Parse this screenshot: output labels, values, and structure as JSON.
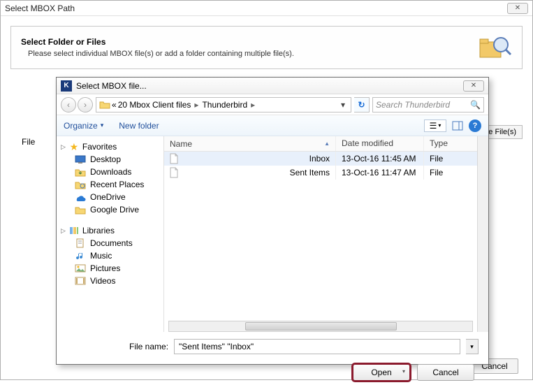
{
  "outer": {
    "title": "Select MBOX Path",
    "info_heading": "Select Folder or Files",
    "info_text": "Please select individual MBOX file(s) or add a folder containing multiple file(s).",
    "e_files_btn": "e File(s)",
    "file_label": "File",
    "cancel": "Cancel"
  },
  "dialog": {
    "title": "Select MBOX file...",
    "breadcrumb": {
      "pre": "«",
      "seg1": "20 Mbox Client files",
      "seg2": "Thunderbird"
    },
    "search_placeholder": "Search Thunderbird",
    "toolbar": {
      "organize": "Organize",
      "newfolder": "New folder"
    },
    "columns": {
      "name": "Name",
      "date": "Date modified",
      "type": "Type"
    },
    "files": [
      {
        "name": "Inbox",
        "date": "13-Oct-16 11:45 AM",
        "type": "File",
        "selected": true
      },
      {
        "name": "Sent Items",
        "date": "13-Oct-16 11:47 AM",
        "type": "File",
        "selected": false
      }
    ],
    "filename_label": "File name:",
    "filename_value": "\"Sent Items\" \"Inbox\"",
    "open": "Open",
    "cancel": "Cancel"
  },
  "sidebar": {
    "favorites": {
      "label": "Favorites",
      "items": [
        {
          "label": "Desktop",
          "icon": "desktop"
        },
        {
          "label": "Downloads",
          "icon": "downloads"
        },
        {
          "label": "Recent Places",
          "icon": "recent"
        },
        {
          "label": "OneDrive",
          "icon": "onedrive"
        },
        {
          "label": "Google Drive",
          "icon": "gdrive"
        }
      ]
    },
    "libraries": {
      "label": "Libraries",
      "items": [
        {
          "label": "Documents",
          "icon": "documents"
        },
        {
          "label": "Music",
          "icon": "music"
        },
        {
          "label": "Pictures",
          "icon": "pictures"
        },
        {
          "label": "Videos",
          "icon": "videos"
        }
      ]
    }
  }
}
